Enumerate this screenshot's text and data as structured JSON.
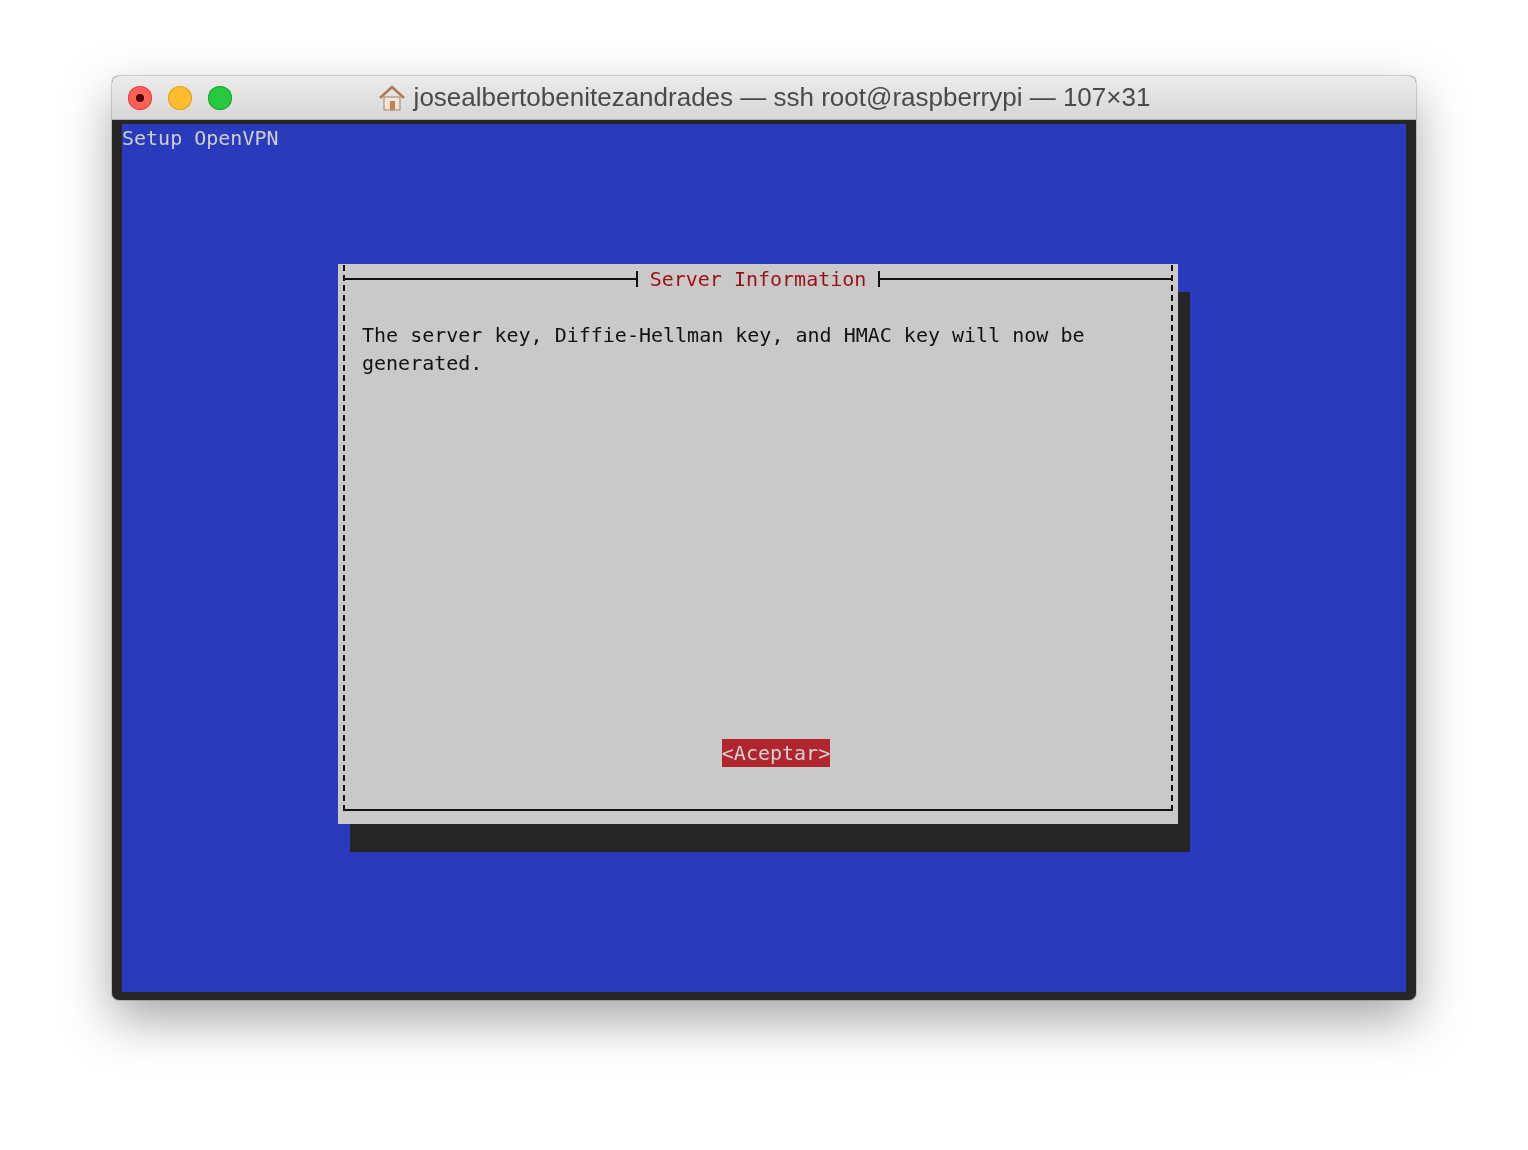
{
  "window": {
    "title": "josealbertobenitezandrades — ssh root@raspberrypi — 107×31"
  },
  "terminal": {
    "header": "Setup OpenVPN"
  },
  "dialog": {
    "title": "Server Information",
    "message": "The server key, Diffie-Hellman key, and HMAC key will now be generated.",
    "buttons": [
      {
        "label": "<Aceptar>",
        "selected": true
      }
    ]
  }
}
